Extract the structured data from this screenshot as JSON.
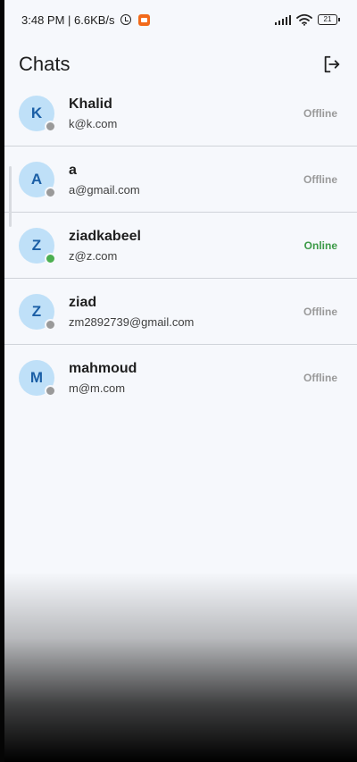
{
  "status_bar": {
    "time_speed": "3:48 PM | 6.6KB/s",
    "battery_level": "21"
  },
  "header": {
    "title": "Chats"
  },
  "colors": {
    "online": "#3c9a47",
    "offline": "#9a9a9a",
    "avatar_bg": "#bfe0f8",
    "avatar_text": "#1b5fa6"
  },
  "chats": [
    {
      "initial": "K",
      "name": "Khalid",
      "email": "k@k.com",
      "status": "Offline",
      "online": false
    },
    {
      "initial": "A",
      "name": "a",
      "email": "a@gmail.com",
      "status": "Offline",
      "online": false
    },
    {
      "initial": "Z",
      "name": "ziadkabeel",
      "email": "z@z.com",
      "status": "Online",
      "online": true
    },
    {
      "initial": "Z",
      "name": "ziad",
      "email": "zm2892739@gmail.com",
      "status": "Offline",
      "online": false
    },
    {
      "initial": "M",
      "name": "mahmoud",
      "email": "m@m.com",
      "status": "Offline",
      "online": false
    }
  ]
}
